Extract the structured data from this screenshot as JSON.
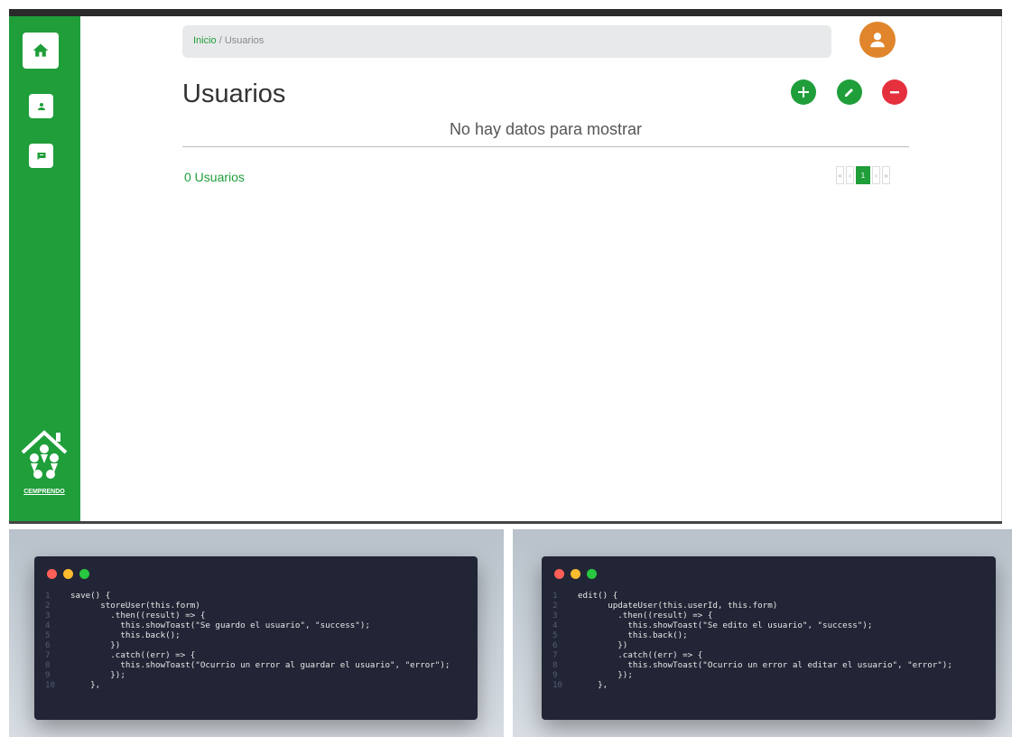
{
  "app": {
    "breadcrumb": {
      "home": "Inicio",
      "separator": " / ",
      "current": "Usuarios"
    },
    "title": "Usuarios",
    "empty_message": "No hay datos para mostrar",
    "count_label": "0 Usuarios",
    "logo_text": "CEMPRENDO",
    "pagination": {
      "first": "«",
      "prev": "‹",
      "current": "1",
      "next": "›",
      "last": "»"
    },
    "colors": {
      "primary": "#1f9e3a",
      "danger": "#e5303d",
      "avatar": "#e0852b"
    },
    "icons": {
      "home": "home-icon",
      "users": "user-icon",
      "chat": "chat-icon",
      "add": "plus-icon",
      "edit": "pencil-icon",
      "delete": "minus-icon",
      "avatar": "user-avatar-icon"
    }
  },
  "code_left": {
    "lines": [
      "save() {",
      "      storeUser(this.form)",
      "        .then((result) => {",
      "          this.showToast(\"Se guardo el usuario\", \"success\");",
      "          this.back();",
      "        })",
      "        .catch((err) => {",
      "          this.showToast(\"Ocurrio un error al guardar el usuario\", \"error\");",
      "        });",
      "    },"
    ]
  },
  "code_right": {
    "lines": [
      "edit() {",
      "      updateUser(this.userId, this.form)",
      "        .then((result) => {",
      "          this.showToast(\"Se edito el usuario\", \"success\");",
      "          this.back();",
      "        })",
      "        .catch((err) => {",
      "          this.showToast(\"Ocurrio un error al editar el usuario\", \"error\");",
      "        });",
      "    },"
    ]
  }
}
